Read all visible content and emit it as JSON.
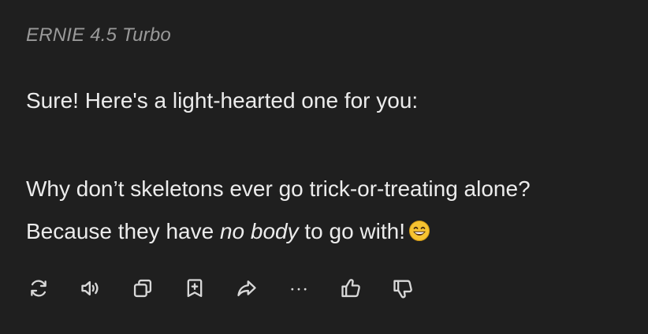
{
  "message": {
    "model_name": "ERNIE 4.5 Turbo",
    "intro": "Sure! Here's a light-hearted one for you:",
    "question": "Why don’t skeletons ever go trick-or-treating alone?",
    "answer_before": "Because they have ",
    "answer_emphasis": "no body",
    "answer_after": " to go with!",
    "emoji": "grinning-face-with-smiling-eyes"
  },
  "actions": [
    {
      "name": "regenerate",
      "icon": "refresh-icon"
    },
    {
      "name": "read-aloud",
      "icon": "speaker-icon"
    },
    {
      "name": "copy",
      "icon": "copy-icon"
    },
    {
      "name": "save-to-bookmarks",
      "icon": "bookmark-add-icon"
    },
    {
      "name": "share",
      "icon": "share-icon"
    },
    {
      "name": "more-options",
      "icon": "ellipsis-icon"
    },
    {
      "name": "like",
      "icon": "thumbs-up-icon"
    },
    {
      "name": "dislike",
      "icon": "thumbs-down-icon"
    }
  ],
  "colors": {
    "background": "#1f1f1f",
    "text": "#ececec",
    "muted": "#9a9a9a",
    "icon": "#d8d8d8",
    "emoji_face": "#f7c331"
  }
}
